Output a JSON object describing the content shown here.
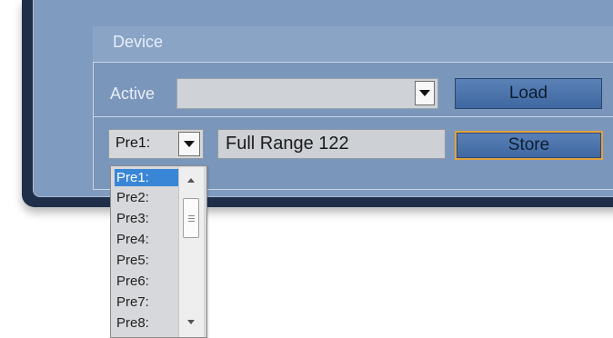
{
  "device_group": {
    "title": "Device",
    "active_label": "Active",
    "active_value": "",
    "load_label": "Load",
    "store_label": "Store"
  },
  "preset": {
    "selected": "Pre1:",
    "name_value": "Full Range 122",
    "options": [
      "Pre1:",
      "Pre2:",
      "Pre3:",
      "Pre4:",
      "Pre5:",
      "Pre6:",
      "Pre7:",
      "Pre8:"
    ]
  },
  "colors": {
    "panel": "#7f9bbf",
    "frame": "#1f2f4a",
    "button": "#4a73ab",
    "store_focus": "#e3a23c",
    "selection": "#3a86d6"
  },
  "icons": {
    "combo_arrow": "chevron-down-icon",
    "scroll_up": "scroll-up-arrow-icon",
    "scroll_down": "scroll-down-arrow-icon"
  }
}
